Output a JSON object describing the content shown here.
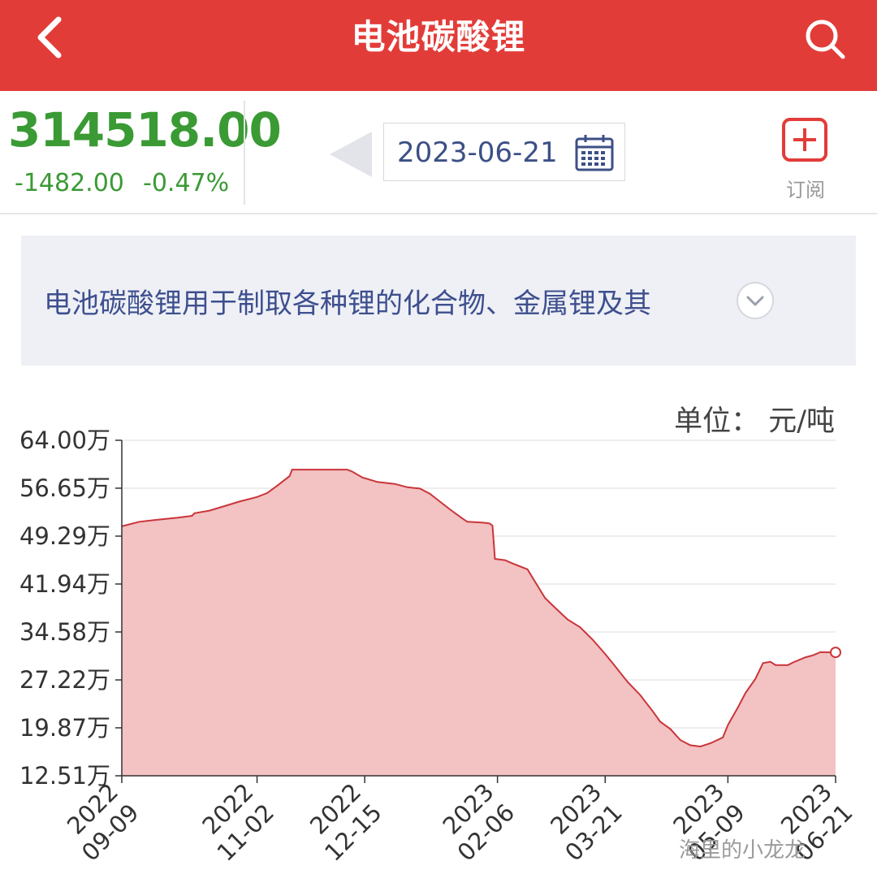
{
  "header": {
    "title": "电池碳酸锂",
    "back_icon": "back-chevron-icon",
    "search_icon": "search-icon"
  },
  "quote": {
    "price": "314518.00",
    "change": "-1482.00",
    "change_pct": "-0.47%",
    "date": "2023-06-21",
    "subscribe_label": "订阅",
    "price_color": "#3a9a34",
    "accent_color": "#e23c39"
  },
  "description": {
    "text": "电池碳酸锂用于制取各种锂的化合物、金属锂及其"
  },
  "unit_label": "单位： 元/吨",
  "watermark": "海里的小龙龙",
  "chart_data": {
    "type": "area",
    "ylim": [
      12.51,
      64.0
    ],
    "y_ticks": [
      "64.00万",
      "56.65万",
      "49.29万",
      "41.94万",
      "34.58万",
      "27.22万",
      "19.87万",
      "12.51万"
    ],
    "y_tick_values": [
      64.0,
      56.65,
      49.29,
      41.94,
      34.58,
      27.22,
      19.87,
      12.51
    ],
    "x_ticks": [
      {
        "year": "2022",
        "md": "09-09",
        "date": "2022-09-09"
      },
      {
        "year": "2022",
        "md": "11-02",
        "date": "2022-11-02"
      },
      {
        "year": "2022",
        "md": "12-15",
        "date": "2022-12-15"
      },
      {
        "year": "2023",
        "md": "02-06",
        "date": "2023-02-06"
      },
      {
        "year": "2023",
        "md": "03-21",
        "date": "2023-03-21"
      },
      {
        "year": "2023",
        "md": "05-09",
        "date": "2023-05-09"
      },
      {
        "year": "2023",
        "md": "06-21",
        "date": "2023-06-21"
      }
    ],
    "grid": true,
    "series": [
      {
        "values": [
          [
            "2022-09-09",
            50.8
          ],
          [
            "2022-09-16",
            51.5
          ],
          [
            "2022-09-23",
            51.8
          ],
          [
            "2022-10-01",
            52.1
          ],
          [
            "2022-10-07",
            52.4
          ],
          [
            "2022-10-08",
            52.8
          ],
          [
            "2022-10-14",
            53.2
          ],
          [
            "2022-10-20",
            53.9
          ],
          [
            "2022-10-26",
            54.6
          ],
          [
            "2022-11-02",
            55.3
          ],
          [
            "2022-11-06",
            55.9
          ],
          [
            "2022-11-10",
            57.0
          ],
          [
            "2022-11-15",
            58.5
          ],
          [
            "2022-11-16",
            59.5
          ],
          [
            "2022-11-20",
            59.5
          ],
          [
            "2022-11-30",
            59.5
          ],
          [
            "2022-12-08",
            59.5
          ],
          [
            "2022-12-10",
            59.2
          ],
          [
            "2022-12-14",
            58.3
          ],
          [
            "2022-12-20",
            57.6
          ],
          [
            "2022-12-27",
            57.3
          ],
          [
            "2023-01-01",
            56.8
          ],
          [
            "2023-01-06",
            56.6
          ],
          [
            "2023-01-10",
            55.8
          ],
          [
            "2023-01-13",
            54.9
          ],
          [
            "2023-01-18",
            53.4
          ],
          [
            "2023-01-23",
            52.0
          ],
          [
            "2023-01-25",
            51.5
          ],
          [
            "2023-01-30",
            51.4
          ],
          [
            "2023-02-02",
            51.3
          ],
          [
            "2023-02-03",
            51.2
          ],
          [
            "2023-02-04",
            50.9
          ],
          [
            "2023-02-05",
            45.8
          ],
          [
            "2023-02-09",
            45.6
          ],
          [
            "2023-02-12",
            45.1
          ],
          [
            "2023-02-18",
            44.2
          ],
          [
            "2023-02-21",
            42.3
          ],
          [
            "2023-02-25",
            39.8
          ],
          [
            "2023-03-01",
            38.3
          ],
          [
            "2023-03-06",
            36.5
          ],
          [
            "2023-03-11",
            35.3
          ],
          [
            "2023-03-16",
            33.4
          ],
          [
            "2023-03-21",
            31.2
          ],
          [
            "2023-03-25",
            29.3
          ],
          [
            "2023-03-30",
            26.9
          ],
          [
            "2023-04-04",
            24.9
          ],
          [
            "2023-04-09",
            22.4
          ],
          [
            "2023-04-12",
            20.8
          ],
          [
            "2023-04-16",
            19.7
          ],
          [
            "2023-04-20",
            18.0
          ],
          [
            "2023-04-24",
            17.2
          ],
          [
            "2023-04-28",
            17.0
          ],
          [
            "2023-05-02",
            17.5
          ],
          [
            "2023-05-07",
            18.4
          ],
          [
            "2023-05-09",
            20.3
          ],
          [
            "2023-05-13",
            23.0
          ],
          [
            "2023-05-16",
            25.2
          ],
          [
            "2023-05-20",
            27.4
          ],
          [
            "2023-05-23",
            29.8
          ],
          [
            "2023-05-26",
            30.0
          ],
          [
            "2023-05-28",
            29.5
          ],
          [
            "2023-06-02",
            29.5
          ],
          [
            "2023-06-04",
            29.9
          ],
          [
            "2023-06-09",
            30.7
          ],
          [
            "2023-06-12",
            31.0
          ],
          [
            "2023-06-15",
            31.5
          ],
          [
            "2023-06-21",
            31.45
          ]
        ]
      }
    ],
    "line_color": "#c9353a",
    "fill_color": "#f3c2c3"
  }
}
